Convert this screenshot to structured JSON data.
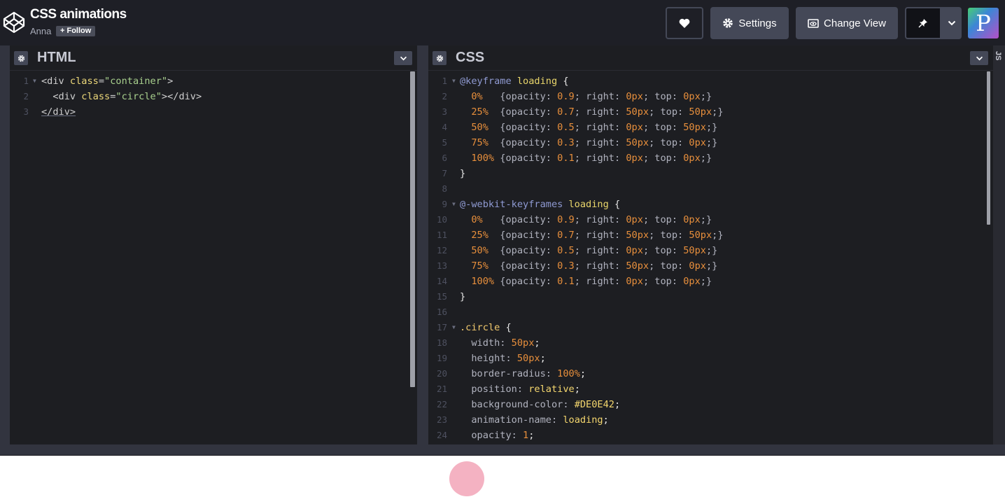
{
  "header": {
    "title": "CSS animations",
    "author": "Anna",
    "follow_label": "+ Follow",
    "settings_label": "Settings",
    "change_view_label": "Change View",
    "avatar_letter": "P"
  },
  "panes": {
    "html": {
      "title": "HTML"
    },
    "css": {
      "title": "CSS"
    },
    "js": {
      "title": "JS"
    }
  },
  "html_code": [
    {
      "n": "1",
      "fold": true,
      "tokens": [
        [
          "t-tag",
          "<div "
        ],
        [
          "t-attr",
          "class"
        ],
        [
          "t-tag",
          "="
        ],
        [
          "t-str",
          "\"container\""
        ],
        [
          "t-tag",
          ">"
        ]
      ]
    },
    {
      "n": "2",
      "fold": false,
      "tokens": [
        [
          "t-tag",
          "  <div "
        ],
        [
          "t-attr",
          "class"
        ],
        [
          "t-tag",
          "="
        ],
        [
          "t-str",
          "\"circle\""
        ],
        [
          "t-tag",
          "></div>"
        ]
      ]
    },
    {
      "n": "3",
      "fold": false,
      "tokens": [
        [
          "t-tag underline",
          "</div>"
        ]
      ]
    }
  ],
  "css_code": [
    {
      "n": "1",
      "fold": true,
      "tokens": [
        [
          "t-at",
          "@keyframe "
        ],
        [
          "t-name",
          "loading"
        ],
        [
          "t-white",
          " {"
        ]
      ]
    },
    {
      "n": "2",
      "fold": false,
      "tokens": [
        [
          "t-num",
          "  0%   "
        ],
        [
          "t-prop",
          "{opacity: "
        ],
        [
          "t-num",
          "0.9"
        ],
        [
          "t-prop",
          "; right: "
        ],
        [
          "t-num",
          "0px"
        ],
        [
          "t-prop",
          "; top: "
        ],
        [
          "t-num",
          "0px"
        ],
        [
          "t-prop",
          ";}"
        ]
      ]
    },
    {
      "n": "3",
      "fold": false,
      "tokens": [
        [
          "t-num",
          "  25%  "
        ],
        [
          "t-prop",
          "{opacity: "
        ],
        [
          "t-num",
          "0.7"
        ],
        [
          "t-prop",
          "; right: "
        ],
        [
          "t-num",
          "50px"
        ],
        [
          "t-prop",
          "; top: "
        ],
        [
          "t-num",
          "50px"
        ],
        [
          "t-prop",
          ";}"
        ]
      ]
    },
    {
      "n": "4",
      "fold": false,
      "tokens": [
        [
          "t-num",
          "  50%  "
        ],
        [
          "t-prop",
          "{opacity: "
        ],
        [
          "t-num",
          "0.5"
        ],
        [
          "t-prop",
          "; right: "
        ],
        [
          "t-num",
          "0px"
        ],
        [
          "t-prop",
          "; top: "
        ],
        [
          "t-num",
          "50px"
        ],
        [
          "t-prop",
          ";}"
        ]
      ]
    },
    {
      "n": "5",
      "fold": false,
      "tokens": [
        [
          "t-num",
          "  75%  "
        ],
        [
          "t-prop",
          "{opacity: "
        ],
        [
          "t-num",
          "0.3"
        ],
        [
          "t-prop",
          "; right: "
        ],
        [
          "t-num",
          "50px"
        ],
        [
          "t-prop",
          "; top: "
        ],
        [
          "t-num",
          "0px"
        ],
        [
          "t-prop",
          ";}"
        ]
      ]
    },
    {
      "n": "6",
      "fold": false,
      "tokens": [
        [
          "t-num",
          "  100% "
        ],
        [
          "t-prop",
          "{opacity: "
        ],
        [
          "t-num",
          "0.1"
        ],
        [
          "t-prop",
          "; right: "
        ],
        [
          "t-num",
          "0px"
        ],
        [
          "t-prop",
          "; top: "
        ],
        [
          "t-num",
          "0px"
        ],
        [
          "t-prop",
          ";}"
        ]
      ]
    },
    {
      "n": "7",
      "fold": false,
      "tokens": [
        [
          "t-white",
          "}"
        ]
      ]
    },
    {
      "n": "8",
      "fold": false,
      "tokens": []
    },
    {
      "n": "9",
      "fold": true,
      "tokens": [
        [
          "t-at",
          "@-webkit-keyframes "
        ],
        [
          "t-name",
          "loading"
        ],
        [
          "t-white",
          " {"
        ]
      ]
    },
    {
      "n": "10",
      "fold": false,
      "tokens": [
        [
          "t-num",
          "  0%   "
        ],
        [
          "t-prop",
          "{opacity: "
        ],
        [
          "t-num",
          "0.9"
        ],
        [
          "t-prop",
          "; right: "
        ],
        [
          "t-num",
          "0px"
        ],
        [
          "t-prop",
          "; top: "
        ],
        [
          "t-num",
          "0px"
        ],
        [
          "t-prop",
          ";}"
        ]
      ]
    },
    {
      "n": "11",
      "fold": false,
      "tokens": [
        [
          "t-num",
          "  25%  "
        ],
        [
          "t-prop",
          "{opacity: "
        ],
        [
          "t-num",
          "0.7"
        ],
        [
          "t-prop",
          "; right: "
        ],
        [
          "t-num",
          "50px"
        ],
        [
          "t-prop",
          "; top: "
        ],
        [
          "t-num",
          "50px"
        ],
        [
          "t-prop",
          ";}"
        ]
      ]
    },
    {
      "n": "12",
      "fold": false,
      "tokens": [
        [
          "t-num",
          "  50%  "
        ],
        [
          "t-prop",
          "{opacity: "
        ],
        [
          "t-num",
          "0.5"
        ],
        [
          "t-prop",
          "; right: "
        ],
        [
          "t-num",
          "0px"
        ],
        [
          "t-prop",
          "; top: "
        ],
        [
          "t-num",
          "50px"
        ],
        [
          "t-prop",
          ";}"
        ]
      ]
    },
    {
      "n": "13",
      "fold": false,
      "tokens": [
        [
          "t-num",
          "  75%  "
        ],
        [
          "t-prop",
          "{opacity: "
        ],
        [
          "t-num",
          "0.3"
        ],
        [
          "t-prop",
          "; right: "
        ],
        [
          "t-num",
          "50px"
        ],
        [
          "t-prop",
          "; top: "
        ],
        [
          "t-num",
          "0px"
        ],
        [
          "t-prop",
          ";}"
        ]
      ]
    },
    {
      "n": "14",
      "fold": false,
      "tokens": [
        [
          "t-num",
          "  100% "
        ],
        [
          "t-prop",
          "{opacity: "
        ],
        [
          "t-num",
          "0.1"
        ],
        [
          "t-prop",
          "; right: "
        ],
        [
          "t-num",
          "0px"
        ],
        [
          "t-prop",
          "; top: "
        ],
        [
          "t-num",
          "0px"
        ],
        [
          "t-prop",
          ";}"
        ]
      ]
    },
    {
      "n": "15",
      "fold": false,
      "tokens": [
        [
          "t-white",
          "}"
        ]
      ]
    },
    {
      "n": "16",
      "fold": false,
      "tokens": []
    },
    {
      "n": "17",
      "fold": true,
      "tokens": [
        [
          "t-sel",
          ".circle"
        ],
        [
          "t-white",
          " {"
        ]
      ]
    },
    {
      "n": "18",
      "fold": false,
      "tokens": [
        [
          "t-prop",
          "  width: "
        ],
        [
          "t-num",
          "50px"
        ],
        [
          "t-white",
          ";"
        ]
      ]
    },
    {
      "n": "19",
      "fold": false,
      "tokens": [
        [
          "t-prop",
          "  height: "
        ],
        [
          "t-num",
          "50px"
        ],
        [
          "t-white",
          ";"
        ]
      ]
    },
    {
      "n": "20",
      "fold": false,
      "tokens": [
        [
          "t-prop",
          "  border-radius: "
        ],
        [
          "t-num",
          "100%"
        ],
        [
          "t-white",
          ";"
        ]
      ]
    },
    {
      "n": "21",
      "fold": false,
      "tokens": [
        [
          "t-prop",
          "  position: "
        ],
        [
          "t-kw",
          "relative"
        ],
        [
          "t-white",
          ";"
        ]
      ]
    },
    {
      "n": "22",
      "fold": false,
      "tokens": [
        [
          "t-prop",
          "  background-color: "
        ],
        [
          "t-kw",
          "#DE0E42"
        ],
        [
          "t-white",
          ";"
        ]
      ]
    },
    {
      "n": "23",
      "fold": false,
      "tokens": [
        [
          "t-prop",
          "  animation-name: "
        ],
        [
          "t-kw",
          "loading"
        ],
        [
          "t-white",
          ";"
        ]
      ]
    },
    {
      "n": "24",
      "fold": false,
      "tokens": [
        [
          "t-prop",
          "  opacity: "
        ],
        [
          "t-num",
          "1"
        ],
        [
          "t-white",
          ";"
        ]
      ]
    }
  ],
  "preview": {
    "circle_color": "#DE0E42"
  }
}
